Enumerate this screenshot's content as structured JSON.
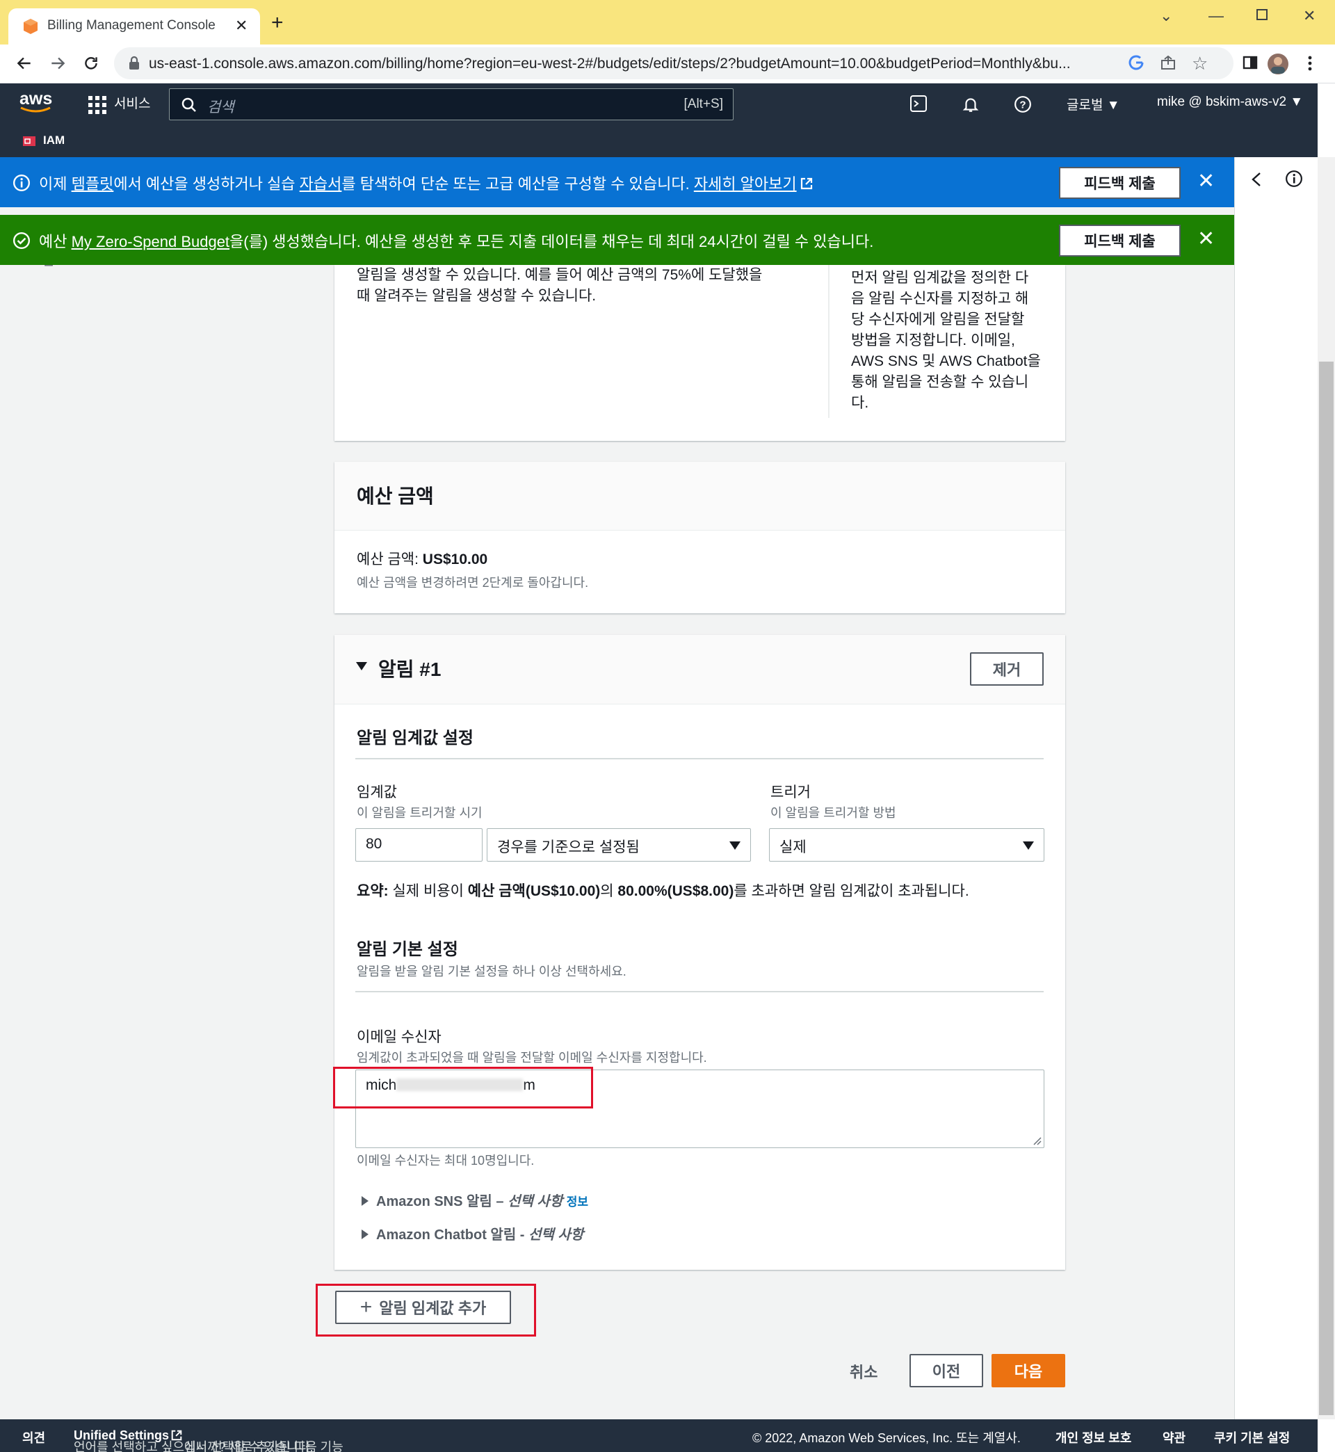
{
  "browser": {
    "tab_title": "Billing Management Console",
    "url": "us-east-1.console.aws.amazon.com/billing/home?region=eu-west-2#/budgets/edit/steps/2?budgetAmount=10.00&budgetPeriod=Monthly&bu..."
  },
  "aws_nav": {
    "logo": "aws",
    "services": "서비스",
    "search_placeholder": "검색",
    "search_shortcut": "[Alt+S]",
    "iam": "IAM",
    "region": "글로벌 ▼",
    "account": "mike @ bskim-aws-v2 ▼"
  },
  "flash": {
    "info": {
      "t1": "이제 ",
      "link1": "템플릿",
      "t2": "에서 예산을 생성하거나 실습 ",
      "link2": "자습서",
      "t3": "를 탐색하여 단순 또는 고급 예산을 구성할 수 있습니다. ",
      "link3": "자세히 알아보기",
      "button": "피드백 제출"
    },
    "success": {
      "t1": "예산 ",
      "link": "My Zero-Spend Budget",
      "t2": "을(를) 생성했습니다. 예산을 생성한 후 모든 지출 데이터를 채우는 데 최대 24시간이 걸릴 수 있습니다.",
      "button": "피드백 제출"
    }
  },
  "sidebar": {
    "step_partial": "검토"
  },
  "intro_card": {
    "left_text1": "알림을 생성할 수 있습니다. 예를 들어 예산 금액의 75%에 도달했을",
    "left_text2": "때 알려주는 알림을 생성할 수 있습니다.",
    "right_lines": [
      "먼저 알림 임계값을 정의한 다",
      "음 알림 수신자를 지정하고 해",
      "당 수신자에게 알림을 전달할",
      "방법을 지정합니다. 이메일,",
      "AWS SNS 및 AWS Chatbot을",
      "통해 알림을 전송할 수 있습니",
      "다."
    ]
  },
  "budget_card": {
    "title": "예산 금액",
    "amount_label": "예산 금액: ",
    "amount_value": "US$10.00",
    "note": "예산 금액을 변경하려면 2단계로 돌아갑니다."
  },
  "alert": {
    "title": "알림 #1",
    "remove": "제거",
    "threshold_section": "알림 임계값 설정",
    "threshold_label": "임계값",
    "threshold_desc": "이 알림을 트리거할 시기",
    "threshold_value": "80",
    "threshold_unit": "경우를 기준으로 설정됨",
    "trigger_label": "트리거",
    "trigger_desc": "이 알림을 트리거할 방법",
    "trigger_value": "실제",
    "summary_k": "요약:",
    "summary_1": " 실제 비용이 ",
    "summary_2": "예산 금액(US$10.00)",
    "summary_3": "의 ",
    "summary_4": "80.00%(US$8.00)",
    "summary_5": "를 초과하면 알림 임계값이 초과됩니다.",
    "pref_section": "알림 기본 설정",
    "pref_desc": "알림을 받을 알림 기본 설정을 하나 이상 선택하세요.",
    "email_label": "이메일 수신자",
    "email_desc": "임계값이 초과되었을 때 알림을 전달할 이메일 수신자를 지정합니다.",
    "email_start": "mich",
    "email_end": "m",
    "email_limit": "이메일 수신자는 최대 10명입니다.",
    "sns_label": "Amazon SNS 알림 – ",
    "sns_optional": "선택 사항",
    "sns_info": "정보",
    "chatbot_label": "Amazon Chatbot 알림 - ",
    "chatbot_optional": "선택 사항"
  },
  "add_threshold": "알림 임계값 추가",
  "actions": {
    "cancel": "취소",
    "prev": "이전",
    "next": "다음"
  },
  "footer": {
    "feedback": "의견",
    "lang_text": "언어를 선택하고 싶으십니까? 새로 추가된 다음 기능",
    "unified": "Unified Settings",
    "lang_text2": "에서 선택할 수 있습니다.",
    "copyright": "© 2022, Amazon Web Services, Inc. 또는 계열사.",
    "privacy": "개인 정보 보호",
    "terms": "약관",
    "cookies": "쿠키 기본 설정"
  },
  "colors": {
    "aws_nav": "#232f3e",
    "info_flash": "#0972d3",
    "success_flash": "#1d8102",
    "primary": "#ec7211",
    "highlight": "#e0102a"
  }
}
